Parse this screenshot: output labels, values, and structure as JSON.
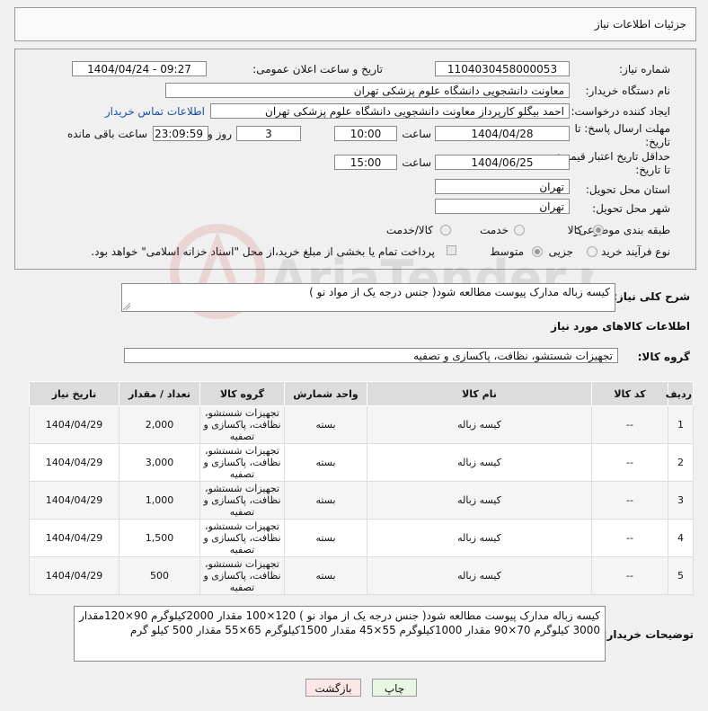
{
  "header": {
    "title": "جزئیات اطلاعات نیاز"
  },
  "form": {
    "need_number_label": "شماره نیاز:",
    "need_number": "1104030458000053",
    "announce_label": "تاریخ و ساعت اعلان عمومی:",
    "announce_value": "1404/04/24 - 09:27",
    "buyer_org_label": "نام دستگاه خریدار:",
    "buyer_org": "معاونت دانشجویی دانشگاه علوم پزشکی تهران",
    "creator_label": "ایجاد کننده درخواست:",
    "creator": "احمد بیگلو کارپرداز معاونت دانشجویی دانشگاه علوم پزشکی تهران",
    "buyer_contact_link": "اطلاعات تماس خریدار",
    "deadline_label_1": "مهلت ارسال پاسخ: تا",
    "deadline_label_2": "تاریخ:",
    "deadline_date": "1404/04/28",
    "time_label": "ساعت",
    "deadline_time": "10:00",
    "days_value": "3",
    "days_label": "روز و",
    "remaining_time": "23:09:59",
    "remaining_label": "ساعت باقی مانده",
    "price_validity_label_1": "حداقل تاریخ اعتبار قیمت:",
    "price_validity_label_2": "تا تاریخ:",
    "price_validity_date": "1404/06/25",
    "price_validity_time": "15:00",
    "province_label": "استان محل تحویل:",
    "province": "تهران",
    "city_label": "شهر محل تحویل:",
    "city": "تهران",
    "category_label": "طبقه بندی موضوعی:",
    "category_options": [
      "کالا",
      "خدمت",
      "کالا/خدمت"
    ],
    "category_selected": "کالا",
    "process_label": "نوع فرآیند خرید :",
    "process_options": [
      "جزیی",
      "متوسط"
    ],
    "payment_note": "پرداخت تمام یا بخشی از مبلغ خرید،از محل \"اسناد خزانه اسلامی\" خواهد بود."
  },
  "description": {
    "label": "شرح کلی نیاز:",
    "value": "کیسه زباله مدارک پیوست مطالعه شود( جنس درجه یک از مواد نو )"
  },
  "goods_section": {
    "title": "اطلاعات کالاهای مورد نیاز",
    "group_label": "گروه کالا:",
    "group_value": "تجهیزات شستشو، نظافت، پاکسازی و تصفیه"
  },
  "table": {
    "headers": [
      "ردیف",
      "کد کالا",
      "نام کالا",
      "واحد شمارش",
      "گروه کالا",
      "تعداد / مقدار",
      "تاریخ نیاز"
    ],
    "rows": [
      [
        "1",
        "--",
        "کیسه زباله",
        "بسته",
        "تجهیزات شستشو، نظافت، پاکسازی و تصفیه",
        "2,000",
        "1404/04/29"
      ],
      [
        "2",
        "--",
        "کیسه زباله",
        "بسته",
        "تجهیزات شستشو، نظافت، پاکسازی و تصفیه",
        "3,000",
        "1404/04/29"
      ],
      [
        "3",
        "--",
        "کیسه زباله",
        "بسته",
        "تجهیزات شستشو، نظافت، پاکسازی و تصفیه",
        "1,000",
        "1404/04/29"
      ],
      [
        "4",
        "--",
        "کیسه زباله",
        "بسته",
        "تجهیزات شستشو، نظافت، پاکسازی و تصفیه",
        "1,500",
        "1404/04/29"
      ],
      [
        "5",
        "--",
        "کیسه زباله",
        "بسته",
        "تجهیزات شستشو، نظافت، پاکسازی و تصفیه",
        "500",
        "1404/04/29"
      ]
    ]
  },
  "buyer_notes": {
    "label": "توضیحات خریدار:",
    "value": "کیسه زباله مدارک پیوست مطالعه شود( جنس درجه یک از مواد نو ) 120×100 مقدار 2000کیلوگرم 90×120مقدار 3000 کیلوگرم 70×90 مقدار 1000کیلوگرم 55×45 مقدار 1500کیلوگرم 65×55 مقدار 500 کیلو گرم"
  },
  "buttons": {
    "print": "چاپ",
    "back": "بازگشت"
  },
  "watermark": "AriaTender.net",
  "colors": {
    "link": "#1a4fa0",
    "back_button_bg": "#fde6e6",
    "print_button_bg": "#e8f6e4"
  }
}
